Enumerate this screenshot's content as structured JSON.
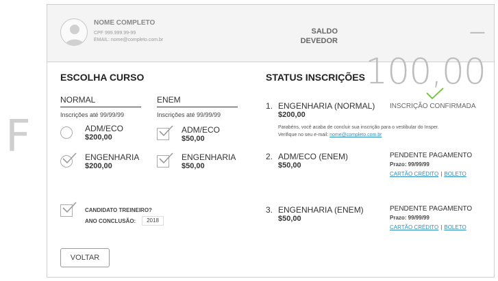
{
  "side_letter": "F",
  "user": {
    "name": "NOME COMPLETO",
    "cpf": "CPF 999.999.99-99",
    "email": "EMAIL: nome@completo.com.br"
  },
  "saldo": {
    "label_line1": "SALDO",
    "label_line2": "DEVEDOR",
    "value": "–100,00"
  },
  "escolha": {
    "title": "ESCOLHA CURSO",
    "normal": {
      "title": "NORMAL",
      "date": "Inscrições até 99/99/99",
      "options": [
        {
          "name": "ADM/ECO",
          "price": "$200,00",
          "checked": false
        },
        {
          "name": "ENGENHARIA",
          "price": "$200,00",
          "checked": true
        }
      ]
    },
    "enem": {
      "title": "ENEM",
      "date": "Inscrições até 99/99/99",
      "options": [
        {
          "name": "ADM/ECO",
          "price": "$50,00",
          "checked": true
        },
        {
          "name": "ENGENHARIA",
          "price": "$50,00",
          "checked": true
        }
      ]
    },
    "treineiro": {
      "question": "CANDIDATO TREINEIRO?",
      "ano_label": "ANO CONCLUSÃO:",
      "ano_value": "2018",
      "checked": true
    },
    "voltar_label": "VOLTAR"
  },
  "status": {
    "title": "STATUS INSCRIÇÕES",
    "items": [
      {
        "num": "1.",
        "name": "ENGENHARIA (NORMAL)",
        "price": "$200,00",
        "status": "INSCRIÇÃO CONFIRMADA",
        "message_line1": "Parabéns, você acaba de concluir sua inscrição para o vestibular do Insper.",
        "message_line2": "Verifique no seu e-mail:",
        "message_email": "nome@completo.com.br"
      },
      {
        "num": "2.",
        "name": "ADM/ECO (ENEM)",
        "price": "$50,00",
        "status": "PENDENTE PAGAMENTO",
        "prazo": "Prazo: 99/99/99",
        "link_cartao": "CARTÃO CRÉDITO",
        "link_sep": "|",
        "link_boleto": "BOLETO"
      },
      {
        "num": "3.",
        "name": "ENGENHARIA (ENEM)",
        "price": "$50,00",
        "status": "PENDENTE PAGAMENTO",
        "prazo": "Prazo: 99/99/99",
        "link_cartao": "CARTÃO CRÉDITO",
        "link_sep": "|",
        "link_boleto": "BOLETO"
      }
    ]
  },
  "colors": {
    "accent_check": "#7dc24a",
    "link": "#2a8fbf"
  }
}
